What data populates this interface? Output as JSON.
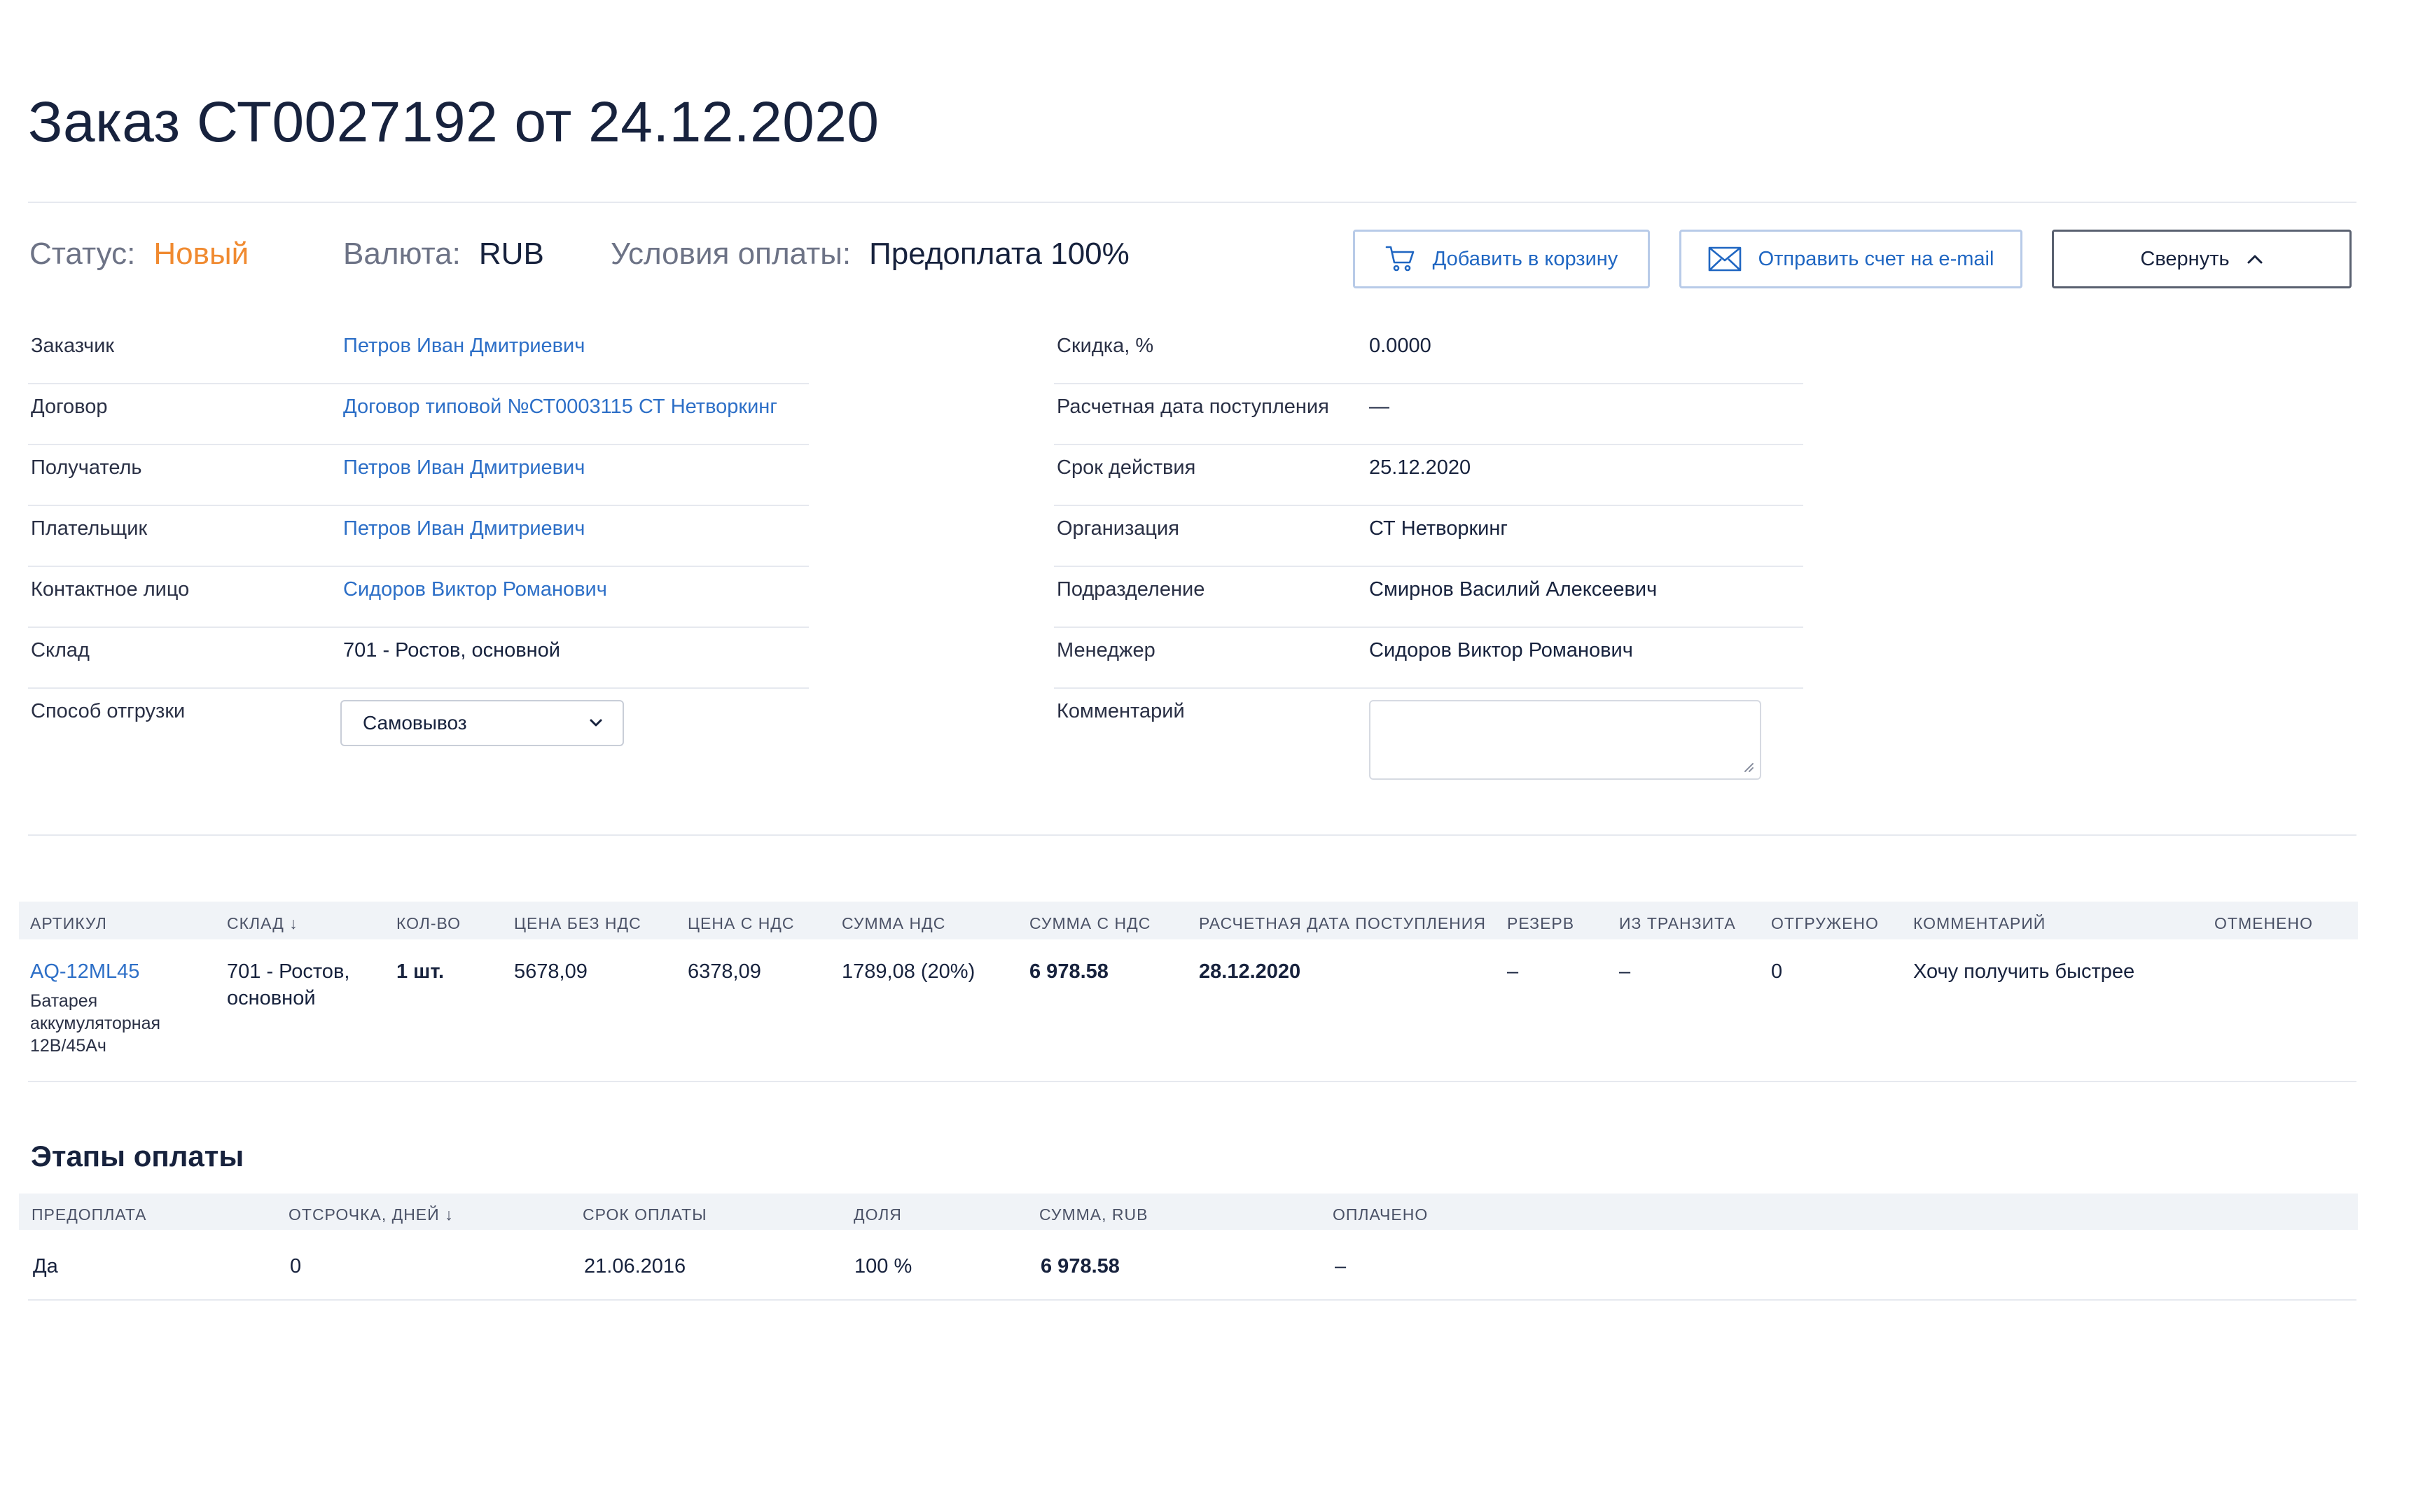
{
  "page": {
    "title": "Заказ СТ0027192 от 24.12.2020"
  },
  "meta": {
    "status_label": "Статус:",
    "status_value": "Новый",
    "currency_label": "Валюта:",
    "currency_value": "RUB",
    "terms_label": "Условия оплаты:",
    "terms_value": "Предоплата 100%"
  },
  "actions": {
    "add_to_cart": "Добавить в корзину",
    "send_invoice": "Отправить счет на e-mail",
    "collapse": "Свернуть"
  },
  "left_fields": [
    {
      "label": "Заказчик",
      "value": "Петров Иван Дмитриевич"
    },
    {
      "label": "Договор",
      "value": "Договор типовой №СТ0003115 СТ Нетворкинг"
    },
    {
      "label": "Получатель",
      "value": "Петров Иван Дмитриевич"
    },
    {
      "label": "Плательщик",
      "value": "Петров Иван Дмитриевич"
    },
    {
      "label": "Контактное лицо",
      "value": "Сидоров Виктор Романович"
    },
    {
      "label": "Склад",
      "value": "701 - Ростов, основной"
    },
    {
      "label": "Способ отгрузки",
      "value": "Самовывоз"
    }
  ],
  "right_fields": [
    {
      "label": "Скидка, %",
      "value": "0.0000"
    },
    {
      "label": "Расчетная дата поступления",
      "value": "—"
    },
    {
      "label": "Срок действия",
      "value": "25.12.2020"
    },
    {
      "label": "Организация",
      "value": "СТ Нетворкинг"
    },
    {
      "label": "Подразделение",
      "value": "Смирнов Василий Алексеевич"
    },
    {
      "label": "Менеджер",
      "value": "Сидоров Виктор Романович"
    },
    {
      "label": "Комментарий",
      "value": ""
    }
  ],
  "items_table": {
    "headers": [
      "Артикул",
      "Склад ↓",
      "Кол-во",
      "Цена без НДС",
      "Цена с НДС",
      "Сумма НДС",
      "Сумма с НДС",
      "Расчетная дата поступления",
      "Резерв",
      "Из транзита",
      "Отгружено",
      "Комментарий",
      "Отменено"
    ],
    "rows": [
      {
        "sku": "AQ-12ML45",
        "name": "Батарея аккумуляторная 12В/45Ач",
        "warehouse": "701 - Ростов, основной",
        "qty": "1 шт.",
        "price_no_vat": "5678,09",
        "price_vat": "6378,09",
        "vat_sum": "1789,08 (20%)",
        "sum_vat": "6 978.58",
        "date": "28.12.2020",
        "reserve": "–",
        "transit": "–",
        "shipped": "0",
        "comment": "Хочу получить быстрее",
        "cancelled": ""
      }
    ]
  },
  "payments": {
    "title": "Этапы оплаты",
    "headers": [
      "Предоплата",
      "Отсрочка, дней ↓",
      "Срок оплаты",
      "Доля",
      "Сумма, RUB",
      "Оплачено"
    ],
    "rows": [
      {
        "prepay": "Да",
        "delay": "0",
        "due": "21.06.2016",
        "share": "100 %",
        "sum": "6 978.58",
        "paid": "–"
      }
    ]
  }
}
